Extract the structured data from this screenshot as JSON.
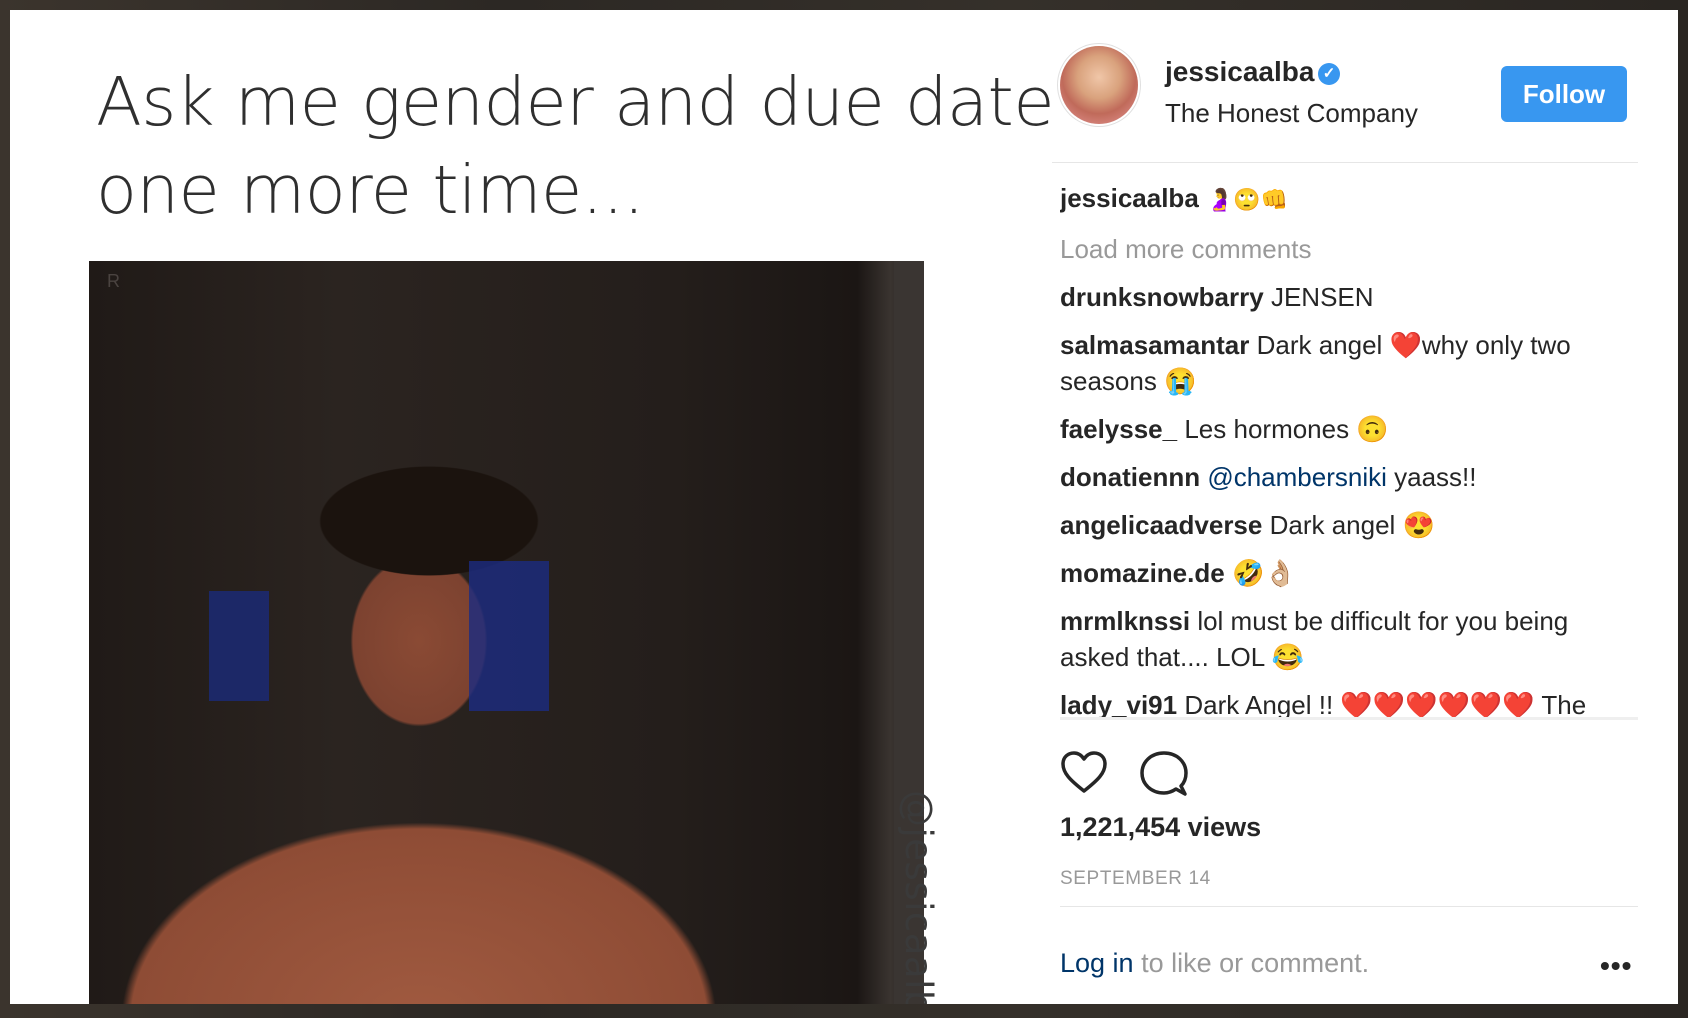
{
  "post": {
    "meme_line1": "Ask me gender and due date",
    "meme_line2": "one more time...",
    "photo_mark": "R",
    "watermark": "@jessicaalba"
  },
  "header": {
    "username": "jessicaalba",
    "verified_icon": "✓",
    "subtitle": "The Honest Company",
    "follow_label": "Follow"
  },
  "caption": {
    "user": "jessicaalba",
    "emojis": "🤰🙄👊"
  },
  "comments": {
    "load_more": "Load more comments",
    "items": [
      {
        "user": "drunksnowbarry",
        "text": "JENSEN"
      },
      {
        "user": "salmasamantar",
        "text": "Dark angel ❤️why only two seasons 😭"
      },
      {
        "user": "faelysse_",
        "text": "Les hormones 🙃"
      },
      {
        "user": "donatiennn",
        "mention": "@chambersniki",
        "text": "yaass!!"
      },
      {
        "user": "angelicaadverse",
        "text": "Dark angel 😍"
      },
      {
        "user": "momazine.de",
        "text": "🤣👌🏼"
      },
      {
        "user": "mrmlknssi",
        "text": "lol must be difficult for you being asked that.... LOL 😂"
      },
      {
        "user": "lady_vi91",
        "text": "Dark Angel !! ❤️❤️❤️❤️❤️❤️ The"
      }
    ]
  },
  "stats": {
    "views": "1,221,454 views",
    "date": "SEPTEMBER 14"
  },
  "footer": {
    "login_link": "Log in",
    "login_rest": "to like or comment.",
    "more_icon": "•••"
  },
  "icons": {
    "heart": "heart-icon",
    "comment": "comment-icon",
    "more": "more-options-icon",
    "verified": "verified-badge-icon"
  },
  "colors": {
    "accent": "#3897f0",
    "link": "#003569",
    "muted": "#999999",
    "text": "#262626"
  }
}
